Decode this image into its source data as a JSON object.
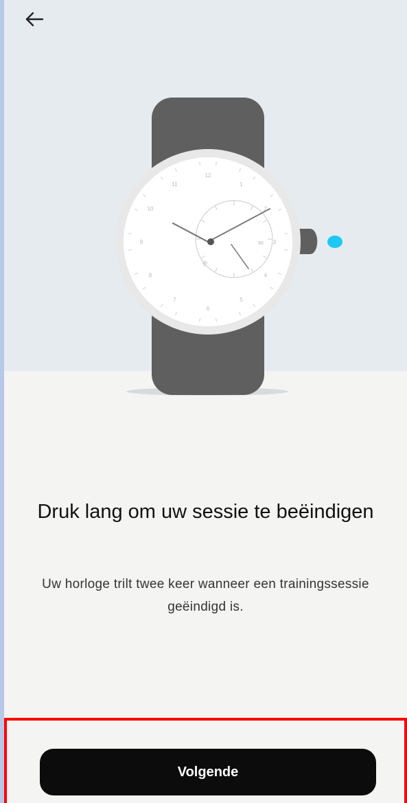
{
  "header": {
    "back_icon": "arrow-left-icon"
  },
  "illustration": {
    "dial_numbers": [
      "12",
      "1",
      "2",
      "3",
      "4",
      "5",
      "6",
      "7",
      "8",
      "9",
      "10",
      "11"
    ],
    "button_indicator_color": "#1ec8f5",
    "strap_color": "#5f5f5f",
    "case_color": "#e8e8e8"
  },
  "content": {
    "title": "Druk lang om uw sessie te beëindigen",
    "description": "Uw horloge trilt twee keer wanneer een trainingssessie geëindigd is."
  },
  "footer": {
    "next_label": "Volgende"
  },
  "colors": {
    "hero_background": "#e6ebf0",
    "page_background": "#f4f4f3",
    "button_background": "#0c0c0c",
    "highlight_frame": "#ff0000"
  }
}
